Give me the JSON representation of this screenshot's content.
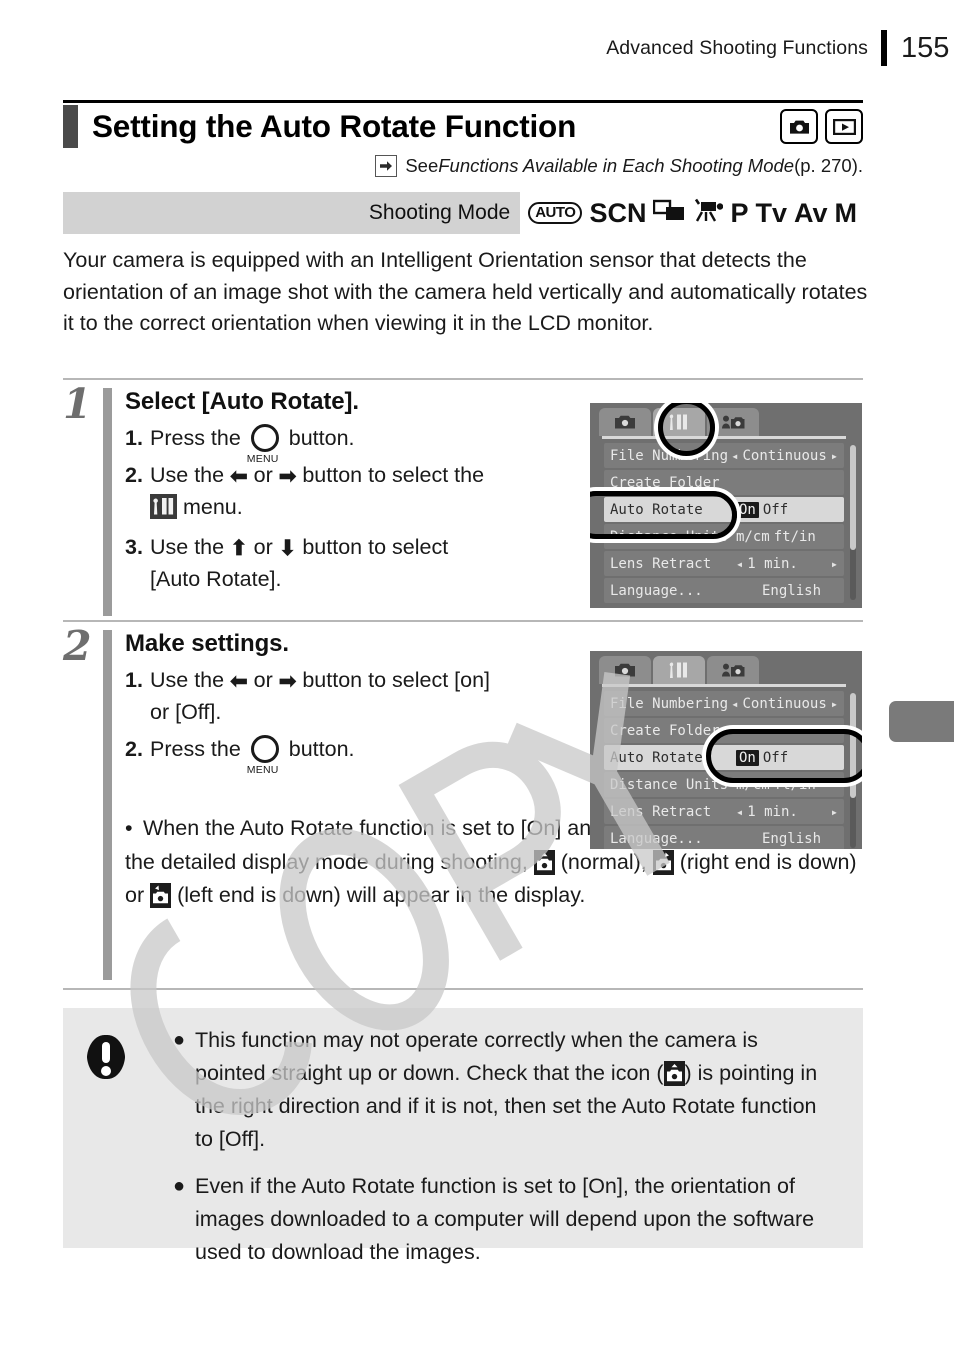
{
  "header": {
    "section_title": "Advanced Shooting Functions",
    "page_number": "155"
  },
  "title": {
    "heading": "Setting the Auto Rotate Function",
    "icons": [
      "shooting-mode-icon",
      "playback-mode-icon"
    ]
  },
  "see_also": {
    "icon": "arrow-right-icon",
    "prefix": "See ",
    "reference": "Functions Available in Each Shooting Mode",
    "suffix": " (p. 270)."
  },
  "shooting_mode_bar": {
    "label": "Shooting Mode",
    "modes": [
      "AUTO",
      "SCN",
      "stitch-assist-icon",
      "movie-icon",
      "P",
      "Tv",
      "Av",
      "M"
    ]
  },
  "intro": "Your camera is equipped with an Intelligent Orientation sensor that detects the orientation of an image shot with the camera held vertically and automatically rotates it to the correct orientation when viewing it in the LCD monitor.",
  "steps": [
    {
      "number": "1",
      "title": "Select [Auto Rotate].",
      "substeps": [
        {
          "n": "1.",
          "pre": "Press the ",
          "icon": "menu-button-icon",
          "post": " button."
        },
        {
          "n": "2.",
          "pre": "Use the ",
          "icon": "left-right-arrow-icons",
          "post": " button to select the ",
          "tail": " menu.",
          "tail_icon": "tools-menu-icon"
        },
        {
          "n": "3.",
          "pre": "Use the ",
          "icon": "up-down-arrow-icons",
          "post": " button to select",
          "tail": "[Auto Rotate]."
        }
      ]
    },
    {
      "number": "2",
      "title": "Make settings.",
      "substeps": [
        {
          "n": "1.",
          "pre": "Use the ",
          "icon": "left-right-arrow-icons",
          "post": " button to select [on]",
          "tail": "or [Off]."
        },
        {
          "n": "2.",
          "pre": "Press the ",
          "icon": "menu-button-icon",
          "post": " button."
        }
      ],
      "note_bullet": "•",
      "note_parts": {
        "p1": "When the Auto Rotate function is set to [On] and the LCD monitor is set to the detailed display mode during shooting, ",
        "p2": " (normal), ",
        "p3": " (right end is down) or ",
        "p4": " (left end is down) will appear in the display."
      }
    }
  ],
  "lcd_screens": [
    {
      "name": "menu-screen-step1",
      "tabs": [
        "camera-tab-icon",
        "tools-tab-icon",
        "mycamera-tab-icon"
      ],
      "active_tab_index": 1,
      "rows": [
        {
          "label": "File Numbering",
          "value": "Continuous",
          "carets": true,
          "selected": false
        },
        {
          "label": "Create Folder",
          "value": "",
          "carets": false,
          "selected": false
        },
        {
          "label": "Auto Rotate",
          "value_on": "On",
          "value_off": "Off",
          "selected": true
        },
        {
          "label": "Distance Units",
          "value_on": "m/cm",
          "value_off": "ft/in",
          "selected": false
        },
        {
          "label": "Lens Retract",
          "value": "1 min.",
          "carets": true,
          "selected": false
        },
        {
          "label": "Language...",
          "value": "English",
          "carets": false,
          "selected": false
        }
      ],
      "highlights": [
        "tools-tab-circle",
        "auto-rotate-row-ellipse"
      ]
    },
    {
      "name": "menu-screen-step2",
      "tabs": [
        "camera-tab-icon",
        "tools-tab-icon",
        "myamera-tab-icon"
      ],
      "active_tab_index": 1,
      "rows": [
        {
          "label": "File Numbering",
          "value": "Continuous",
          "carets": true,
          "selected": false
        },
        {
          "label": "Create Folder",
          "value": "",
          "carets": false,
          "selected": false
        },
        {
          "label": "Auto Rotate",
          "value_on": "On",
          "value_off": "Off",
          "selected": true
        },
        {
          "label": "Distance Units",
          "value_on": "m/cm",
          "value_off": "ft/in",
          "selected": false
        },
        {
          "label": "Lens Retract",
          "value": "1 min.",
          "carets": true,
          "selected": false
        },
        {
          "label": "Language...",
          "value": "English",
          "carets": false,
          "selected": false
        }
      ],
      "highlights": [
        "on-off-value-ellipse"
      ]
    }
  ],
  "caution": {
    "icon": "exclamation-icon",
    "items": [
      {
        "bullet": "●",
        "p1": "This function may not operate correctly when the camera is pointed straight up or down. Check that the icon (",
        "p2": ") is pointing in the right direction and if it is not, then set the Auto Rotate function to [Off]."
      },
      {
        "bullet": "●",
        "text": "Even if the Auto Rotate function is set to [On], the orientation of images downloaded to a computer will depend upon the software used to download the images."
      }
    ]
  },
  "watermark": "COPY",
  "colors": {
    "title_bar": "#4a4a4a",
    "step_bar": "#9b9b9b",
    "step_number": "#6e6e6e",
    "mode_bar_bg": "#d2d2d2",
    "caution_bg": "#e8e8e8",
    "lcd_bg": "#6f6f6f",
    "thumb_tab": "#7a7a7a"
  }
}
